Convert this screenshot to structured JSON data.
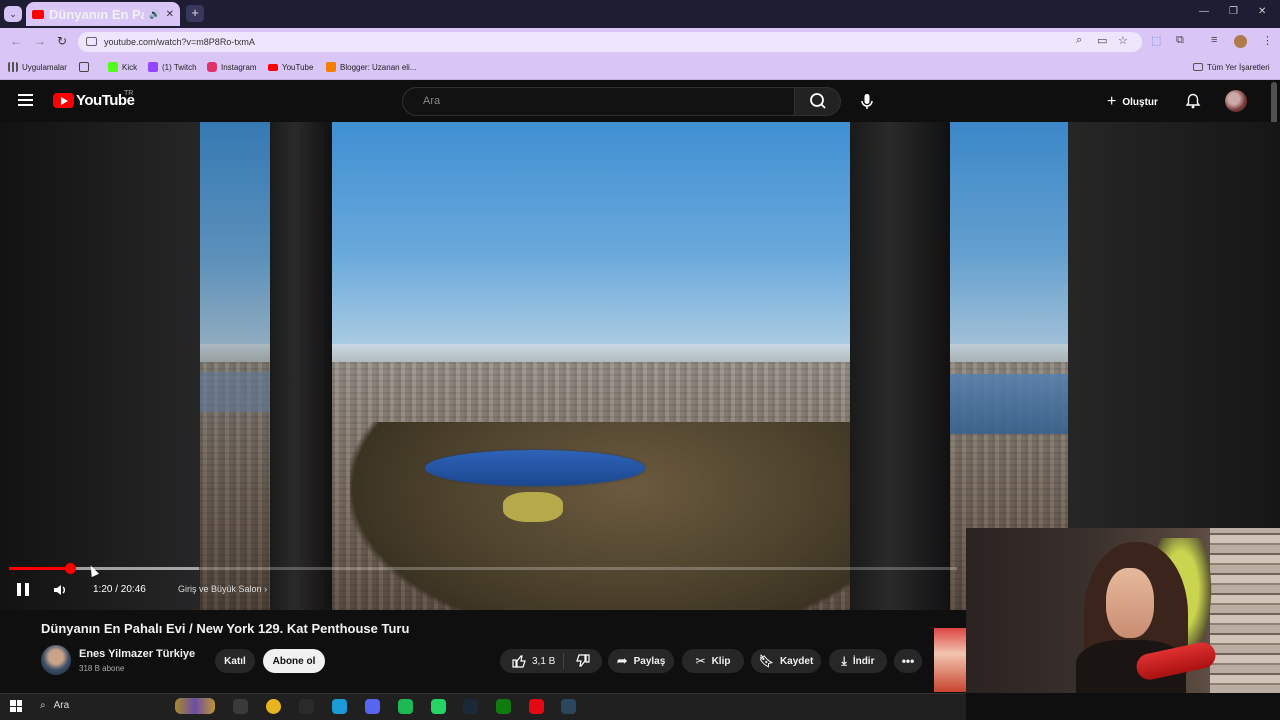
{
  "browser": {
    "tab_title": "Dünyanın En Pahalı Evi / Ne",
    "url": "youtube.com/watch?v=m8P8Ro-txmA",
    "bookmarks": [
      {
        "label": "Uygulamalar",
        "icon": "apps-grid-icon",
        "color": "#5a5a5a"
      },
      {
        "label": "",
        "icon": "grid-icon",
        "color": "#444444"
      },
      {
        "label": "Kick",
        "icon": "kick-icon",
        "color": "#53fc18"
      },
      {
        "label": "(1) Twitch",
        "icon": "twitch-icon",
        "color": "#9146ff"
      },
      {
        "label": "Instagram",
        "icon": "instagram-icon",
        "color": "#e1306c"
      },
      {
        "label": "YouTube",
        "icon": "youtube-icon",
        "color": "#ff0000"
      },
      {
        "label": "Blogger: Uzanan eli...",
        "icon": "blogger-icon",
        "color": "#f57d00"
      }
    ],
    "all_bookmarks": "Tüm Yer İşaretleri"
  },
  "youtube": {
    "logo_text": "YouTube",
    "country_code": "TR",
    "search_placeholder": "Ara",
    "create_label": "Oluştur",
    "brand_color": "#ff0000"
  },
  "player": {
    "current_time": "1:20",
    "duration": "20:46",
    "time_display": "1:20 / 20:46",
    "chapter": "Giriş ve Büyük Salon",
    "chapter_arrow": "›",
    "progress_fraction": 0.064
  },
  "video": {
    "title": "Dünyanın En Pahalı Evi / New York 129. Kat Penthouse Turu",
    "channel_name": "Enes Yilmazer Türkiye",
    "subscribers": "318 B abone",
    "join_label": "Katıl",
    "subscribe_label": "Abone ol",
    "likes": "3,1 B",
    "share_label": "Paylaş",
    "clip_label": "Klip",
    "save_label": "Kaydet",
    "download_label": "İndir"
  },
  "taskbar": {
    "search_label": "Ara",
    "apps": [
      {
        "icon": "task-view-icon",
        "color": "#3a3a3a"
      },
      {
        "icon": "chrome-icon",
        "color": "#e8b51f"
      },
      {
        "icon": "obs-icon",
        "color": "#2a2a2a"
      },
      {
        "icon": "edge-icon",
        "color": "#1a9bd8"
      },
      {
        "icon": "discord-icon",
        "color": "#5865f2"
      },
      {
        "icon": "spotify-icon",
        "color": "#1db954"
      },
      {
        "icon": "whatsapp-icon",
        "color": "#25d366"
      },
      {
        "icon": "steam-icon",
        "color": "#1b2838"
      },
      {
        "icon": "xbox-icon",
        "color": "#107c10"
      },
      {
        "icon": "netflix-icon",
        "color": "#e50914"
      },
      {
        "icon": "steam-alt-icon",
        "color": "#2a475e"
      }
    ]
  }
}
